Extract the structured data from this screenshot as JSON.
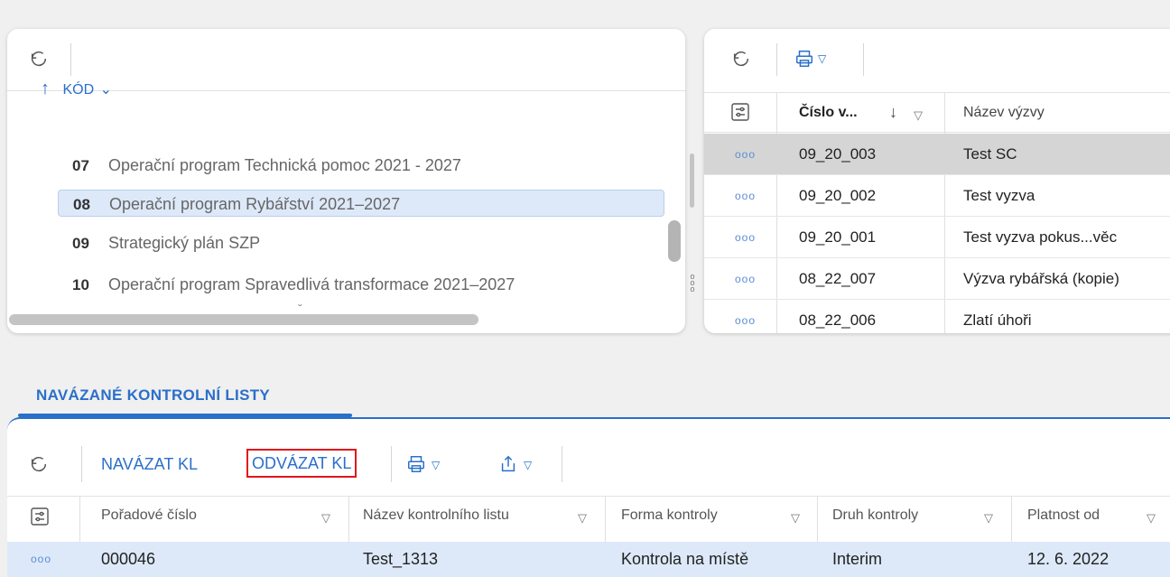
{
  "left_panel": {
    "sort_arrow": "↑",
    "sort_label": "KÓD",
    "sort_chevron": "⌄",
    "rows": [
      {
        "code": "07",
        "name": "Operační program Technická pomoc 2021 - 2027"
      },
      {
        "code": "08",
        "name": "Operační program Rybářství 2021–2027"
      },
      {
        "code": "09",
        "name": "Strategický plán SZP"
      },
      {
        "code": "10",
        "name": "Operační program Spravedlivá transformace 2021–2027"
      }
    ],
    "partial_next": "ˇ"
  },
  "right_panel": {
    "col_cislo": "Číslo v...",
    "col_nazev": "Název výzvy",
    "sort_arrow": "↓",
    "filter_symbol": "▽",
    "rows": [
      {
        "id": "09_20_003",
        "name": "Test SC",
        "active": true
      },
      {
        "id": "09_20_002",
        "name": "Test vyzva"
      },
      {
        "id": "09_20_001",
        "name": "Test vyzva pokus...věc"
      },
      {
        "id": "08_22_007",
        "name": "Výzva rybářská (kopie)"
      },
      {
        "id": "08_22_006",
        "name": "Zlatí úhoři"
      }
    ]
  },
  "tabs": {
    "active_tab": "NAVÁZANÉ KONTROLNÍ LISTY"
  },
  "bottom_toolbar": {
    "navazat": "NAVÁZAT KL",
    "odvazat": "ODVÁZAT KL",
    "dropdown_symbol": "▽"
  },
  "bottom_grid": {
    "headers": [
      "Pořadové číslo",
      "Název kontrolního listu",
      "Forma kontroly",
      "Druh kontroly",
      "Platnost od"
    ],
    "filter_symbol": "▽",
    "row": {
      "poradove": "000046",
      "nazev": "Test_1313",
      "forma": "Kontrola na místě",
      "druh": "Interim",
      "platnost": "12. 6. 2022"
    }
  },
  "icons": {
    "refresh": "refresh-icon",
    "print": "print-icon",
    "export": "export-icon",
    "column_settings": "column-settings-icon",
    "row_menu": "more-dots-icon",
    "splitter": "splitter-handle-icon"
  },
  "colors": {
    "accent": "#2a6fc9",
    "highlight_box": "#e1161c",
    "selected_row": "#dde9f9",
    "active_row": "#d5d5d5"
  }
}
